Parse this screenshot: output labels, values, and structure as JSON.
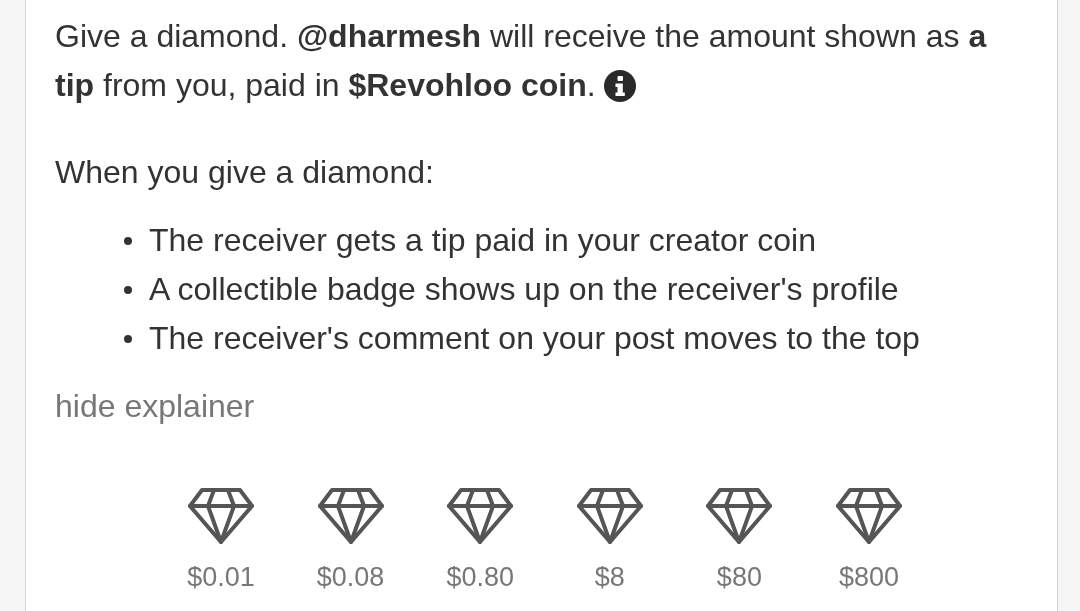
{
  "explainer": {
    "intro_lines": [
      "Give a diamond. **@dharmesh** will receive the amount shown as **a**",
      "**tip** from you, paid in **$Revohloo coin**."
    ],
    "heading": "When you give a diamond:",
    "bullets": [
      "The receiver gets a tip paid in your creator coin",
      "A collectible badge shows up on the receiver's profile",
      "The receiver's comment on your post moves to the top"
    ],
    "toggle": "hide explainer"
  },
  "diamonds": [
    {
      "amount": "$0.01"
    },
    {
      "amount": "$0.08"
    },
    {
      "amount": "$0.80"
    },
    {
      "amount": "$8"
    },
    {
      "amount": "$80"
    },
    {
      "amount": "$800"
    }
  ]
}
